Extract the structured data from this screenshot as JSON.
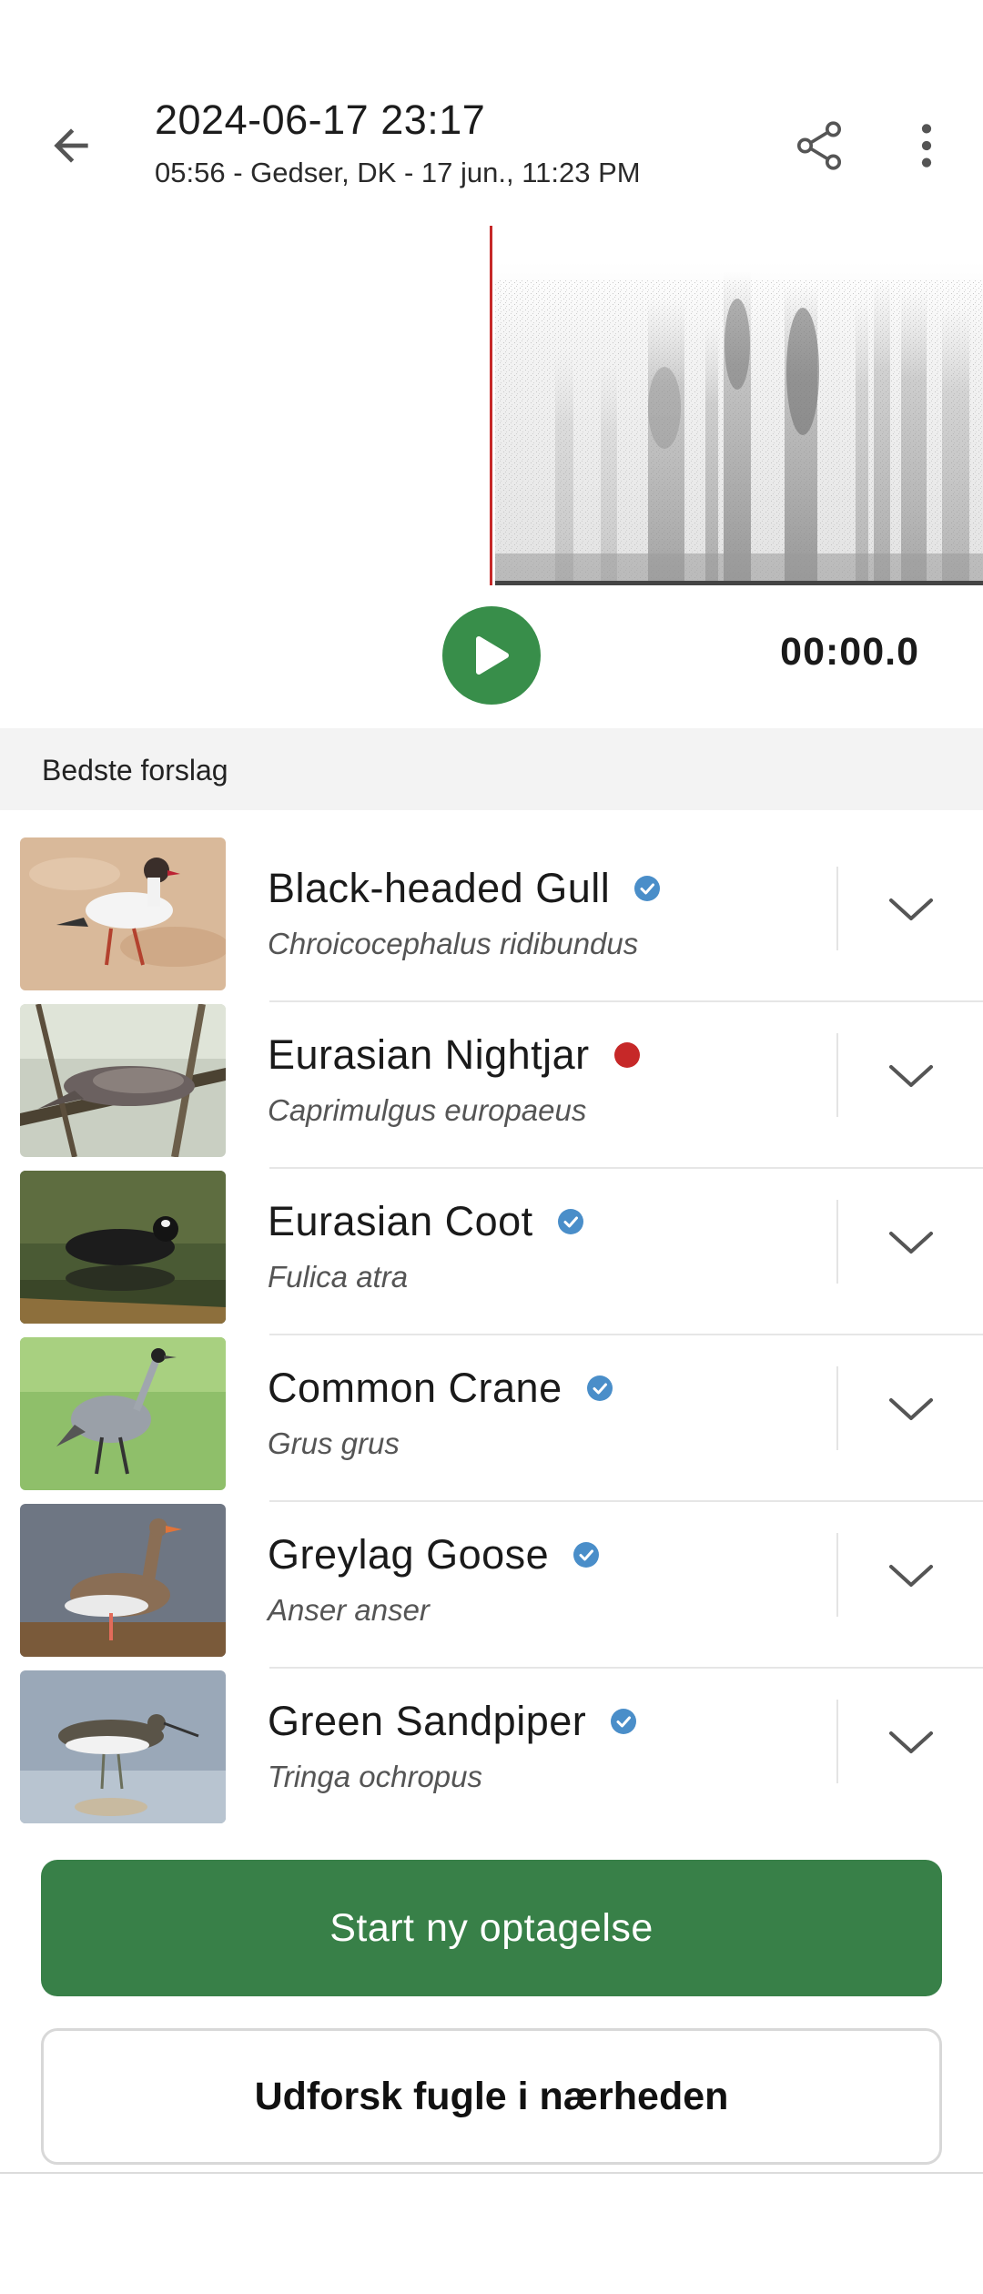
{
  "header": {
    "title": "2024-06-17 23:17",
    "subtitle": "05:56 - Gedser, DK - 17 jun., 11:23 PM",
    "back_icon": "arrow-left-icon",
    "share_icon": "share-icon",
    "menu_icon": "more-vert-icon"
  },
  "player": {
    "time": "00:00.0",
    "play_icon": "play-icon"
  },
  "section": {
    "label": "Bedste forslag"
  },
  "suggestions": [
    {
      "common": "Black-headed Gull",
      "scientific": "Chroicocephalus ridibundus",
      "badge": "verified",
      "badge_color": "#4a8ec9"
    },
    {
      "common": "Eurasian Nightjar",
      "scientific": "Caprimulgus europaeus",
      "badge": "rare",
      "badge_color": "#c62828"
    },
    {
      "common": "Eurasian Coot",
      "scientific": "Fulica atra",
      "badge": "verified",
      "badge_color": "#4a8ec9"
    },
    {
      "common": "Common Crane",
      "scientific": "Grus grus",
      "badge": "verified",
      "badge_color": "#4a8ec9"
    },
    {
      "common": "Greylag Goose",
      "scientific": "Anser anser",
      "badge": "verified",
      "badge_color": "#4a8ec9"
    },
    {
      "common": "Green Sandpiper",
      "scientific": "Tringa ochropus",
      "badge": "verified",
      "badge_color": "#4a8ec9"
    }
  ],
  "actions": {
    "primary": "Start ny optagelse",
    "secondary": "Udforsk fugle i nærheden"
  },
  "colors": {
    "accent": "#388048",
    "playhead": "#c62828"
  }
}
